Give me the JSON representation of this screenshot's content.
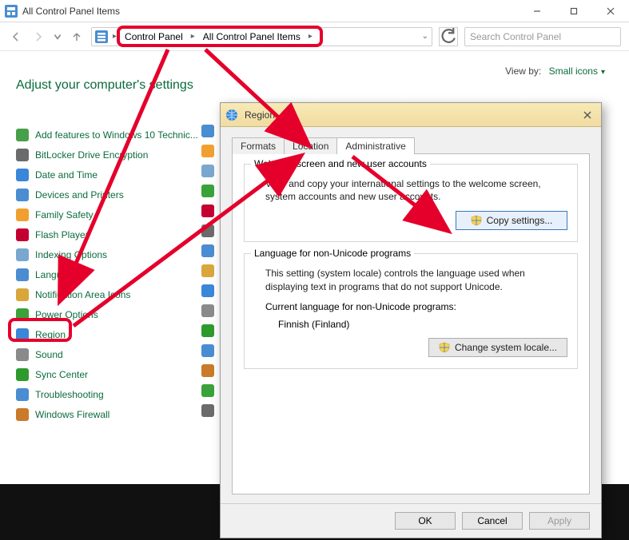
{
  "window": {
    "title": "All Control Panel Items"
  },
  "breadcrumb": {
    "root": "Control Panel",
    "current": "All Control Panel Items"
  },
  "search": {
    "placeholder": "Search Control Panel"
  },
  "heading": "Adjust your computer's settings",
  "viewby": {
    "label": "View by:",
    "value": "Small icons"
  },
  "items": [
    {
      "label": "Add features to Windows 10 Technic...",
      "color": "#46a049"
    },
    {
      "label": "BitLocker Drive Encryption",
      "color": "#6b6b6b"
    },
    {
      "label": "Date and Time",
      "color": "#3a86d8"
    },
    {
      "label": "Devices and Printers",
      "color": "#4a8dd1"
    },
    {
      "label": "Family Safety",
      "color": "#f0a030"
    },
    {
      "label": "Flash Player",
      "color": "#c3002f"
    },
    {
      "label": "Indexing Options",
      "color": "#7aa7cf"
    },
    {
      "label": "Language",
      "color": "#4a8dd1"
    },
    {
      "label": "Notification Area Icons",
      "color": "#d8a63a"
    },
    {
      "label": "Power Options",
      "color": "#3aa23a"
    },
    {
      "label": "Region",
      "color": "#3a86d8"
    },
    {
      "label": "Sound",
      "color": "#8a8a8a"
    },
    {
      "label": "Sync Center",
      "color": "#2e9a2e"
    },
    {
      "label": "Troubleshooting",
      "color": "#4a8dd1"
    },
    {
      "label": "Windows Firewall",
      "color": "#c97a2a"
    }
  ],
  "dialog": {
    "title": "Region",
    "tabs": [
      "Formats",
      "Location",
      "Administrative"
    ],
    "active_tab": 2,
    "welcome_group": {
      "legend": "Welcome screen and new user accounts",
      "text": "View and copy your international settings to the welcome screen, system accounts and new user accounts.",
      "button": "Copy settings..."
    },
    "nonunicode_group": {
      "legend": "Language for non-Unicode programs",
      "text": "This setting (system locale) controls the language used when displaying text in programs that do not support Unicode.",
      "current_label": "Current language for non-Unicode programs:",
      "current_value": "Finnish (Finland)",
      "button": "Change system locale..."
    },
    "footer": {
      "ok": "OK",
      "cancel": "Cancel",
      "apply": "Apply"
    }
  },
  "highlights": {
    "breadcrumb": true,
    "admin_tab": true,
    "copy_settings": true,
    "region_item": true
  }
}
